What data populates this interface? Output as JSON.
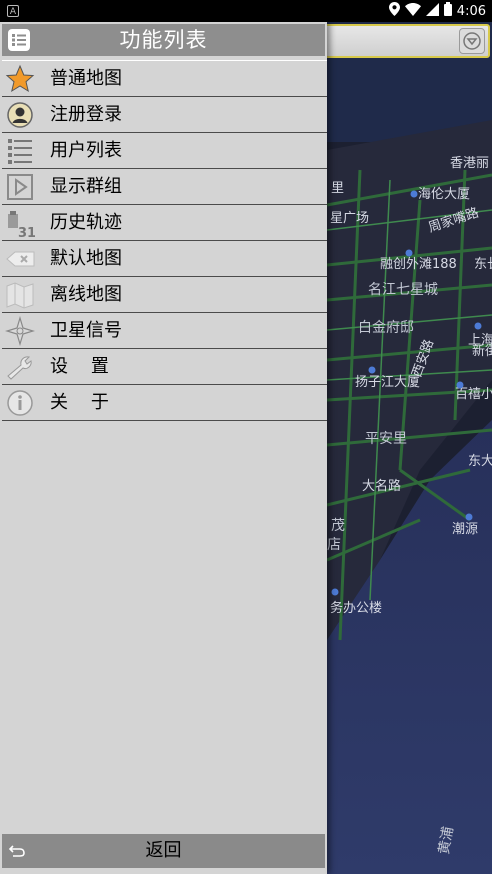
{
  "status_bar": {
    "left_icon": "A",
    "time": "4:06",
    "icons": [
      "location-icon",
      "wifi-icon",
      "signal-icon",
      "battery-icon"
    ]
  },
  "map": {
    "labels": [
      "香港丽",
      "海伦大厦",
      "周家嘴路",
      "星广场",
      "融创外滩188",
      "东长",
      "名江七星城",
      "白金府邸",
      "西安路",
      "上海",
      "新街",
      "扬子江大厦",
      "百禧小区",
      "平安里",
      "东大",
      "大名路",
      "茂",
      "店",
      "潮源",
      "务办公楼",
      "黄浦",
      "里"
    ]
  },
  "drawer": {
    "title": "功能列表",
    "items": [
      {
        "label": "普通地图",
        "icon": "star-icon"
      },
      {
        "label": "注册登录",
        "icon": "user-avatar-icon"
      },
      {
        "label": "用户列表",
        "icon": "list-icon"
      },
      {
        "label": "显示群组",
        "icon": "play-box-icon"
      },
      {
        "label": "历史轨迹",
        "icon": "calendar-31-icon"
      },
      {
        "label": "默认地图",
        "icon": "backspace-icon"
      },
      {
        "label": "离线地图",
        "icon": "folded-map-icon"
      },
      {
        "label": "卫星信号",
        "icon": "compass-star-icon"
      },
      {
        "label": "设    置",
        "icon": "wrench-icon"
      },
      {
        "label": "关    于",
        "icon": "info-icon"
      }
    ],
    "footer_label": "返回"
  }
}
